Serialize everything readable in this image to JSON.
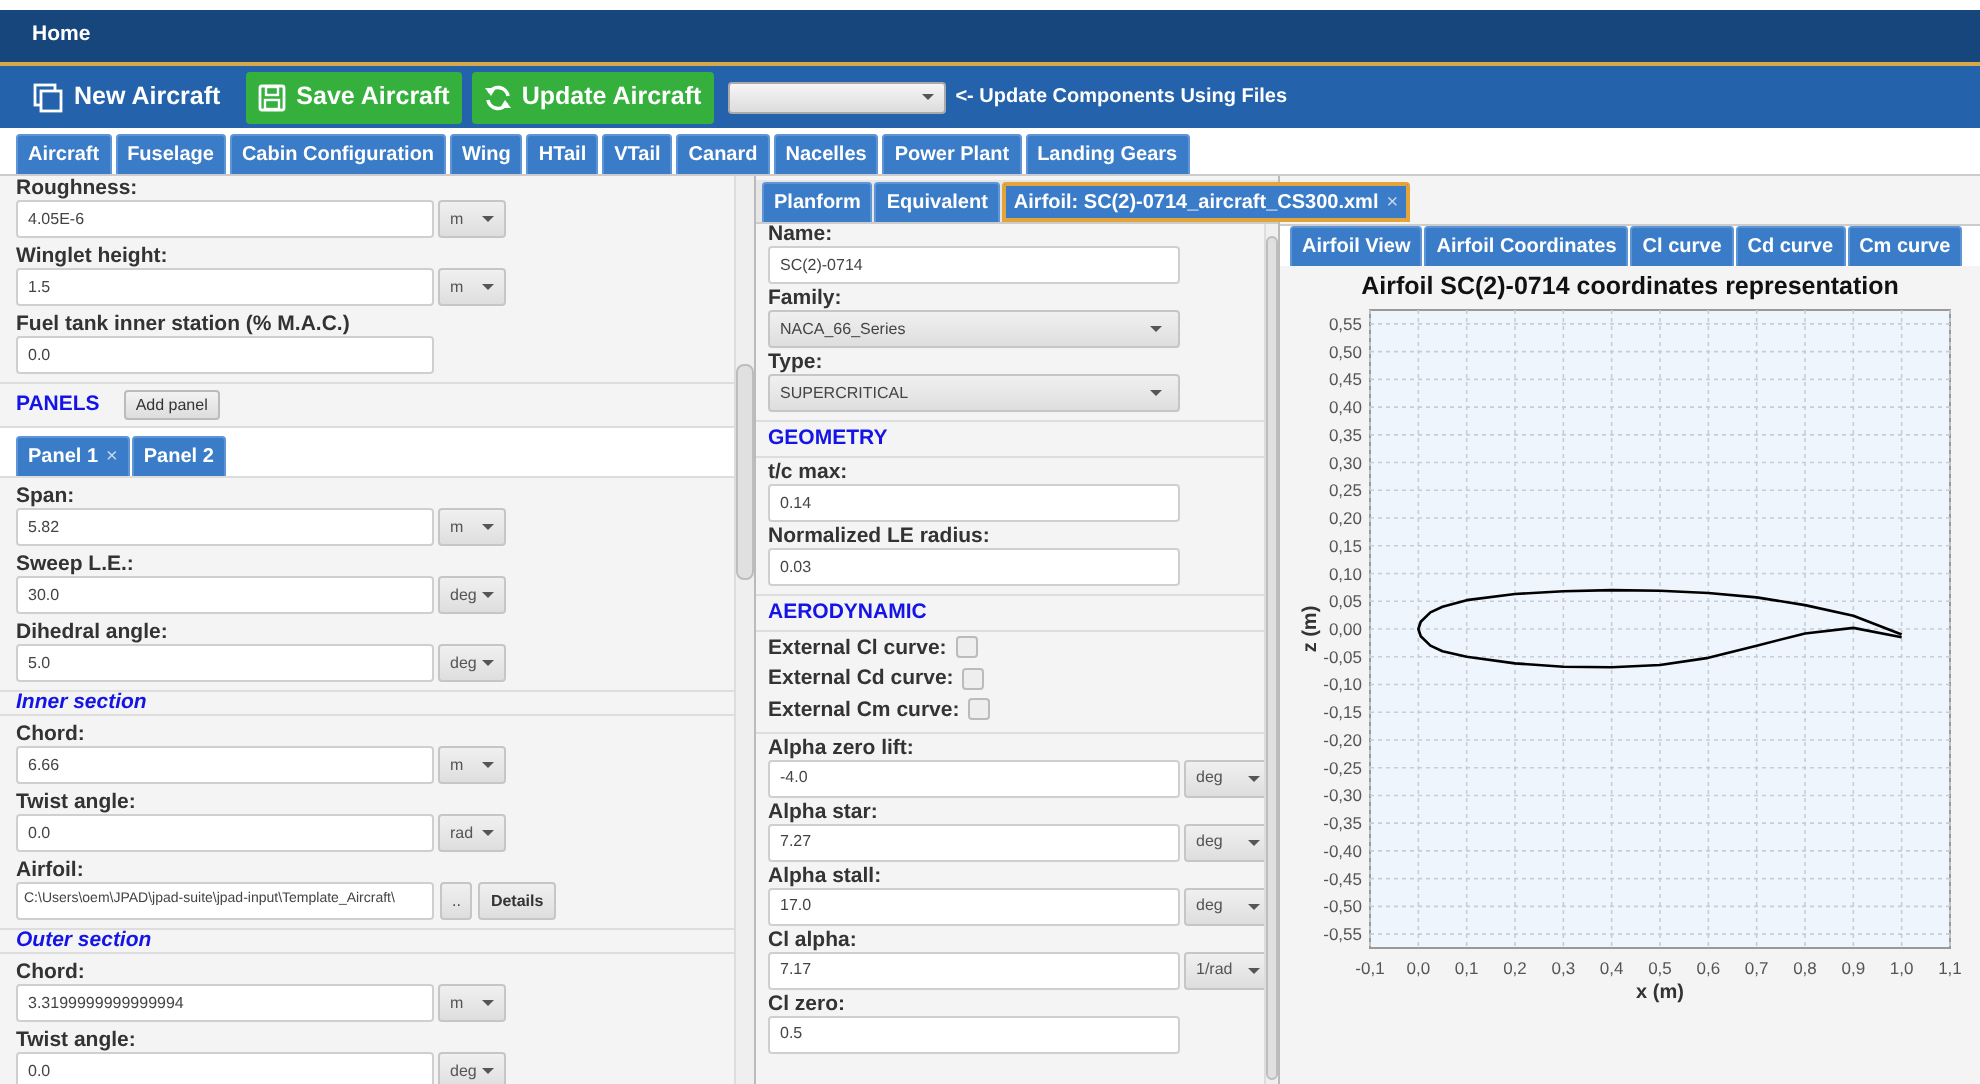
{
  "window": {
    "title": "Home"
  },
  "toolbar": {
    "new_button": "New Aircraft",
    "save_button": "Save Aircraft",
    "update_button": "Update Aircraft",
    "hint": "<- Update Components Using Files"
  },
  "component_tabs": [
    {
      "label": "Aircraft"
    },
    {
      "label": "Fuselage"
    },
    {
      "label": "Cabin Configuration"
    },
    {
      "label": "Wing"
    },
    {
      "label": "HTail"
    },
    {
      "label": "VTail"
    },
    {
      "label": "Canard"
    },
    {
      "label": "Nacelles"
    },
    {
      "label": "Power Plant"
    },
    {
      "label": "Landing Gears"
    }
  ],
  "left_panel": {
    "items": [
      {
        "kind": "field",
        "label": "Roughness:",
        "value": "4.05E-6",
        "unit": "m"
      },
      {
        "kind": "field",
        "label": "Winglet height:",
        "value": "1.5",
        "unit": "m"
      },
      {
        "kind": "field",
        "label": "Fuel tank inner station (% M.A.C.)",
        "value": "0.0"
      },
      {
        "kind": "group",
        "title": "PANELS",
        "button": "Add panel"
      },
      {
        "kind": "tabs",
        "tabs": [
          {
            "label": "Panel 1",
            "close": "×"
          },
          {
            "label": "Panel 2"
          }
        ]
      },
      {
        "kind": "field",
        "label": "Span:",
        "value": "5.82",
        "unit": "m"
      },
      {
        "kind": "field",
        "label": "Sweep L.E.:",
        "value": "30.0",
        "unit": "deg"
      },
      {
        "kind": "field",
        "label": "Dihedral angle:",
        "value": "5.0",
        "unit": "deg"
      },
      {
        "kind": "section",
        "title": "Inner section"
      },
      {
        "kind": "field",
        "label": "Chord:",
        "value": "6.66",
        "unit": "m"
      },
      {
        "kind": "field",
        "label": "Twist angle:",
        "value": "0.0",
        "unit": "rad"
      },
      {
        "kind": "file",
        "label": "Airfoil:",
        "value": "C:\\Users\\oem\\JPAD\\jpad-suite\\jpad-input\\Template_Aircraft\\",
        "browse": "..",
        "details": "Details"
      },
      {
        "kind": "section",
        "title": "Outer section"
      },
      {
        "kind": "field",
        "label": "Chord:",
        "value": "3.3199999999999994",
        "unit": "m"
      },
      {
        "kind": "field",
        "label": "Twist angle:",
        "value": "0.0",
        "unit": "deg"
      }
    ]
  },
  "airfoil_tabs": [
    {
      "label": "Planform",
      "selected": false
    },
    {
      "label": "Equivalent",
      "selected": false
    },
    {
      "label": "Airfoil: SC(2)-0714_aircraft_CS300.xml",
      "selected": true,
      "close": "×"
    }
  ],
  "airfoil_panel": {
    "items": [
      {
        "kind": "field",
        "label": "Name:",
        "value": "SC(2)-0714"
      },
      {
        "kind": "select",
        "label": "Family:",
        "value": "NACA_66_Series"
      },
      {
        "kind": "select",
        "label": "Type:",
        "value": "SUPERCRITICAL"
      },
      {
        "kind": "group",
        "title": "GEOMETRY"
      },
      {
        "kind": "field",
        "label": "t/c max:",
        "value": "0.14"
      },
      {
        "kind": "field",
        "label": "Normalized LE radius:",
        "value": "0.03"
      },
      {
        "kind": "group",
        "title": "AERODYNAMIC"
      },
      {
        "kind": "check",
        "label": "External Cl curve:",
        "checked": false
      },
      {
        "kind": "check",
        "label": "External Cd curve:",
        "checked": false
      },
      {
        "kind": "check",
        "label": "External Cm curve:",
        "checked": false
      },
      {
        "kind": "field",
        "label": "Alpha zero lift:",
        "value": "-4.0",
        "unit": "deg"
      },
      {
        "kind": "field",
        "label": "Alpha star:",
        "value": "7.27",
        "unit": "deg"
      },
      {
        "kind": "field",
        "label": "Alpha stall:",
        "value": "17.0",
        "unit": "deg"
      },
      {
        "kind": "field",
        "label": "Cl alpha:",
        "value": "7.17",
        "unit": "1/rad"
      },
      {
        "kind": "field",
        "label": "Cl zero:",
        "value": "0.5"
      }
    ]
  },
  "chart_tabs": [
    {
      "label": "Airfoil View"
    },
    {
      "label": "Airfoil Coordinates"
    },
    {
      "label": "Cl curve"
    },
    {
      "label": "Cd curve"
    },
    {
      "label": "Cm curve"
    }
  ],
  "chart": {
    "chart_data": {
      "type": "line",
      "title": "Airfoil SC(2)-0714 coordinates representation",
      "xlabel": "x (m)",
      "ylabel": "z (m)",
      "x": [
        1.0,
        0.9,
        0.8,
        0.7,
        0.6,
        0.5,
        0.4,
        0.3,
        0.2,
        0.1,
        0.05,
        0.025,
        0.005,
        0,
        0.005,
        0.025,
        0.05,
        0.1,
        0.2,
        0.3,
        0.4,
        0.5,
        0.6,
        0.7,
        0.8,
        0.9,
        1.0
      ],
      "series": [
        {
          "color": "#000000",
          "values": [
            -0.01,
            0.024,
            0.043,
            0.057,
            0.065,
            0.069,
            0.07,
            0.068,
            0.063,
            0.052,
            0.04,
            0.03,
            0.013,
            0,
            -0.013,
            -0.03,
            -0.04,
            -0.05,
            -0.062,
            -0.068,
            -0.069,
            -0.065,
            -0.052,
            -0.03,
            -0.008,
            0.002,
            -0.015
          ]
        }
      ],
      "grid": true,
      "xlim": [
        -0.1,
        1.1
      ],
      "ylim": [
        -0.575,
        0.575
      ],
      "xticks": [
        {
          "value": -0.1,
          "label": "-0,1"
        },
        {
          "value": 0,
          "label": "0,0"
        },
        {
          "value": 0.1,
          "label": "0,1"
        },
        {
          "value": 0.2,
          "label": "0,2"
        },
        {
          "value": 0.3,
          "label": "0,3"
        },
        {
          "value": 0.4,
          "label": "0,4"
        },
        {
          "value": 0.5,
          "label": "0,5"
        },
        {
          "value": 0.6,
          "label": "0,6"
        },
        {
          "value": 0.7,
          "label": "0,7"
        },
        {
          "value": 0.8,
          "label": "0,8"
        },
        {
          "value": 0.9,
          "label": "0,9"
        },
        {
          "value": 1.0,
          "label": "1,0"
        },
        {
          "value": 1.1,
          "label": "1,1"
        }
      ],
      "yticks": [
        {
          "value": 0.55,
          "label": "0,55"
        },
        {
          "value": 0.5,
          "label": "0,50"
        },
        {
          "value": 0.45,
          "label": "0,45"
        },
        {
          "value": 0.4,
          "label": "0,40"
        },
        {
          "value": 0.35,
          "label": "0,35"
        },
        {
          "value": 0.3,
          "label": "0,30"
        },
        {
          "value": 0.25,
          "label": "0,25"
        },
        {
          "value": 0.2,
          "label": "0,20"
        },
        {
          "value": 0.15,
          "label": "0,15"
        },
        {
          "value": 0.1,
          "label": "0,10"
        },
        {
          "value": 0.05,
          "label": "0,05"
        },
        {
          "value": 0,
          "label": "0,00"
        },
        {
          "value": -0.05,
          "label": "-0,05"
        },
        {
          "value": -0.1,
          "label": "-0,10"
        },
        {
          "value": -0.15,
          "label": "-0,15"
        },
        {
          "value": -0.2,
          "label": "-0,20"
        },
        {
          "value": -0.25,
          "label": "-0,25"
        },
        {
          "value": -0.3,
          "label": "-0,30"
        },
        {
          "value": -0.35,
          "label": "-0,35"
        },
        {
          "value": -0.4,
          "label": "-0,40"
        },
        {
          "value": -0.45,
          "label": "-0,45"
        },
        {
          "value": -0.5,
          "label": "-0,50"
        },
        {
          "value": -0.55,
          "label": "-0,55"
        }
      ]
    }
  }
}
